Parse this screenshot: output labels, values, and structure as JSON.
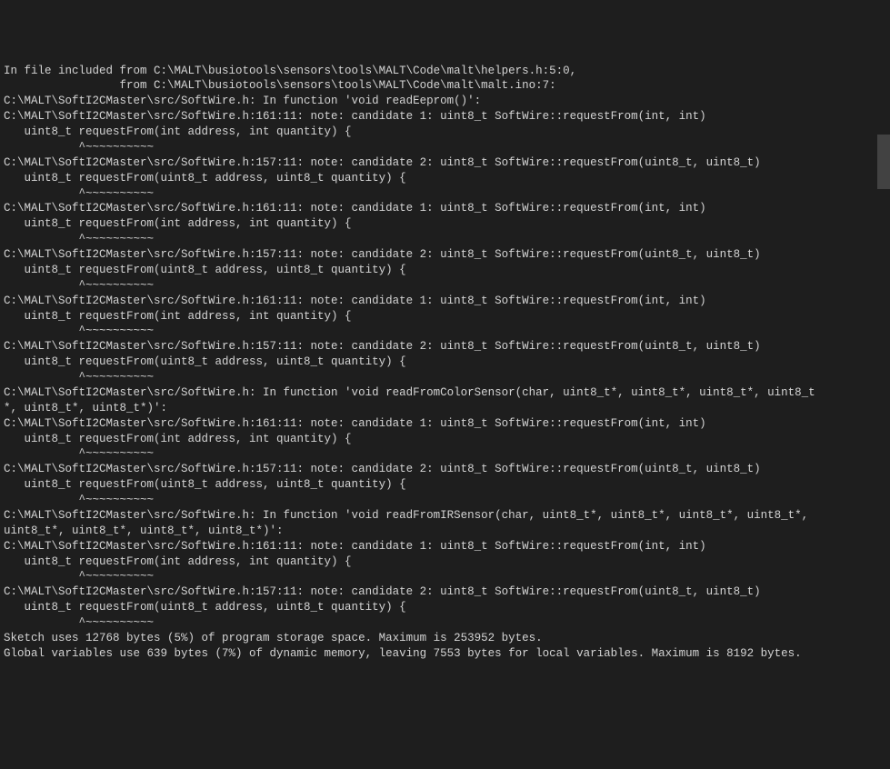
{
  "console": {
    "lines": [
      "In file included from C:\\MALT\\busiotools\\sensors\\tools\\MALT\\Code\\malt\\helpers.h:5:0,",
      "                 from C:\\MALT\\busiotools\\sensors\\tools\\MALT\\Code\\malt\\malt.ino:7:",
      "C:\\MALT\\SoftI2CMaster\\src/SoftWire.h: In function 'void readEeprom()':",
      "C:\\MALT\\SoftI2CMaster\\src/SoftWire.h:161:11: note: candidate 1: uint8_t SoftWire::requestFrom(int, int)",
      "   uint8_t requestFrom(int address, int quantity) {",
      "           ^~~~~~~~~~~",
      "C:\\MALT\\SoftI2CMaster\\src/SoftWire.h:157:11: note: candidate 2: uint8_t SoftWire::requestFrom(uint8_t, uint8_t)",
      "   uint8_t requestFrom(uint8_t address, uint8_t quantity) {",
      "           ^~~~~~~~~~~",
      "C:\\MALT\\SoftI2CMaster\\src/SoftWire.h:161:11: note: candidate 1: uint8_t SoftWire::requestFrom(int, int)",
      "   uint8_t requestFrom(int address, int quantity) {",
      "           ^~~~~~~~~~~",
      "C:\\MALT\\SoftI2CMaster\\src/SoftWire.h:157:11: note: candidate 2: uint8_t SoftWire::requestFrom(uint8_t, uint8_t)",
      "   uint8_t requestFrom(uint8_t address, uint8_t quantity) {",
      "           ^~~~~~~~~~~",
      "C:\\MALT\\SoftI2CMaster\\src/SoftWire.h:161:11: note: candidate 1: uint8_t SoftWire::requestFrom(int, int)",
      "   uint8_t requestFrom(int address, int quantity) {",
      "           ^~~~~~~~~~~",
      "C:\\MALT\\SoftI2CMaster\\src/SoftWire.h:157:11: note: candidate 2: uint8_t SoftWire::requestFrom(uint8_t, uint8_t)",
      "   uint8_t requestFrom(uint8_t address, uint8_t quantity) {",
      "           ^~~~~~~~~~~",
      "C:\\MALT\\SoftI2CMaster\\src/SoftWire.h: In function 'void readFromColorSensor(char, uint8_t*, uint8_t*, uint8_t*, uint8_t",
      "*, uint8_t*, uint8_t*)':",
      "C:\\MALT\\SoftI2CMaster\\src/SoftWire.h:161:11: note: candidate 1: uint8_t SoftWire::requestFrom(int, int)",
      "   uint8_t requestFrom(int address, int quantity) {",
      "           ^~~~~~~~~~~",
      "C:\\MALT\\SoftI2CMaster\\src/SoftWire.h:157:11: note: candidate 2: uint8_t SoftWire::requestFrom(uint8_t, uint8_t)",
      "   uint8_t requestFrom(uint8_t address, uint8_t quantity) {",
      "           ^~~~~~~~~~~",
      "C:\\MALT\\SoftI2CMaster\\src/SoftWire.h: In function 'void readFromIRSensor(char, uint8_t*, uint8_t*, uint8_t*, uint8_t*, ",
      "uint8_t*, uint8_t*, uint8_t*, uint8_t*)':",
      "C:\\MALT\\SoftI2CMaster\\src/SoftWire.h:161:11: note: candidate 1: uint8_t SoftWire::requestFrom(int, int)",
      "   uint8_t requestFrom(int address, int quantity) {",
      "           ^~~~~~~~~~~",
      "C:\\MALT\\SoftI2CMaster\\src/SoftWire.h:157:11: note: candidate 2: uint8_t SoftWire::requestFrom(uint8_t, uint8_t)",
      "   uint8_t requestFrom(uint8_t address, uint8_t quantity) {",
      "           ^~~~~~~~~~~",
      "Sketch uses 12768 bytes (5%) of program storage space. Maximum is 253952 bytes.",
      "Global variables use 639 bytes (7%) of dynamic memory, leaving 7553 bytes for local variables. Maximum is 8192 bytes."
    ]
  }
}
